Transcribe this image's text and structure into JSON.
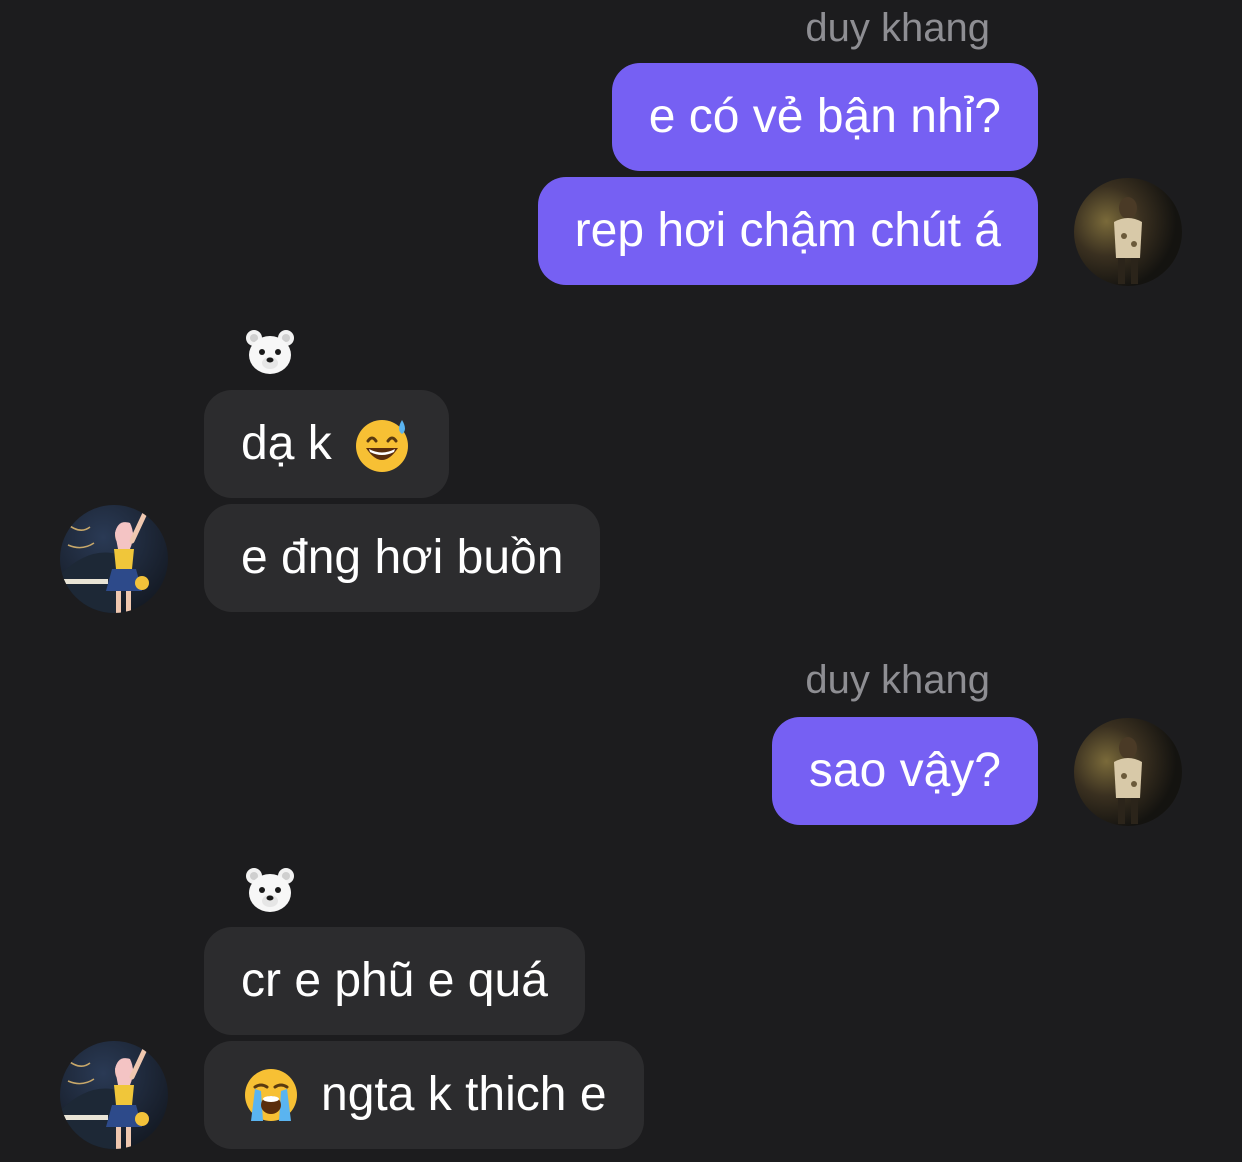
{
  "conversation": {
    "outgoing_sender": "duy khang",
    "incoming_sender": "🐻‍❄️",
    "groups": [
      {
        "direction": "outgoing",
        "sender": "duy khang",
        "messages": [
          "e có vẻ bận nhỉ?",
          "rep hơi chậm chút á"
        ]
      },
      {
        "direction": "incoming",
        "sender": "🐻‍❄️",
        "messages": [
          "dạ k",
          "e đng hơi buồn"
        ],
        "message_emojis": [
          "grinning-sweat-emoji",
          ""
        ]
      },
      {
        "direction": "outgoing",
        "sender": "duy khang",
        "messages": [
          "sao vậy?"
        ]
      },
      {
        "direction": "incoming",
        "sender": "🐻‍❄️",
        "messages": [
          "cr e phũ e quá",
          "ngta k thich e"
        ],
        "message_emojis": [
          "",
          "loudly-crying-emoji"
        ]
      }
    ]
  },
  "colors": {
    "background": "#1c1c1e",
    "outgoing_bubble": "#7660f3",
    "incoming_bubble": "#2c2c2e",
    "sender_name": "#8e8e93",
    "text": "#ffffff"
  }
}
